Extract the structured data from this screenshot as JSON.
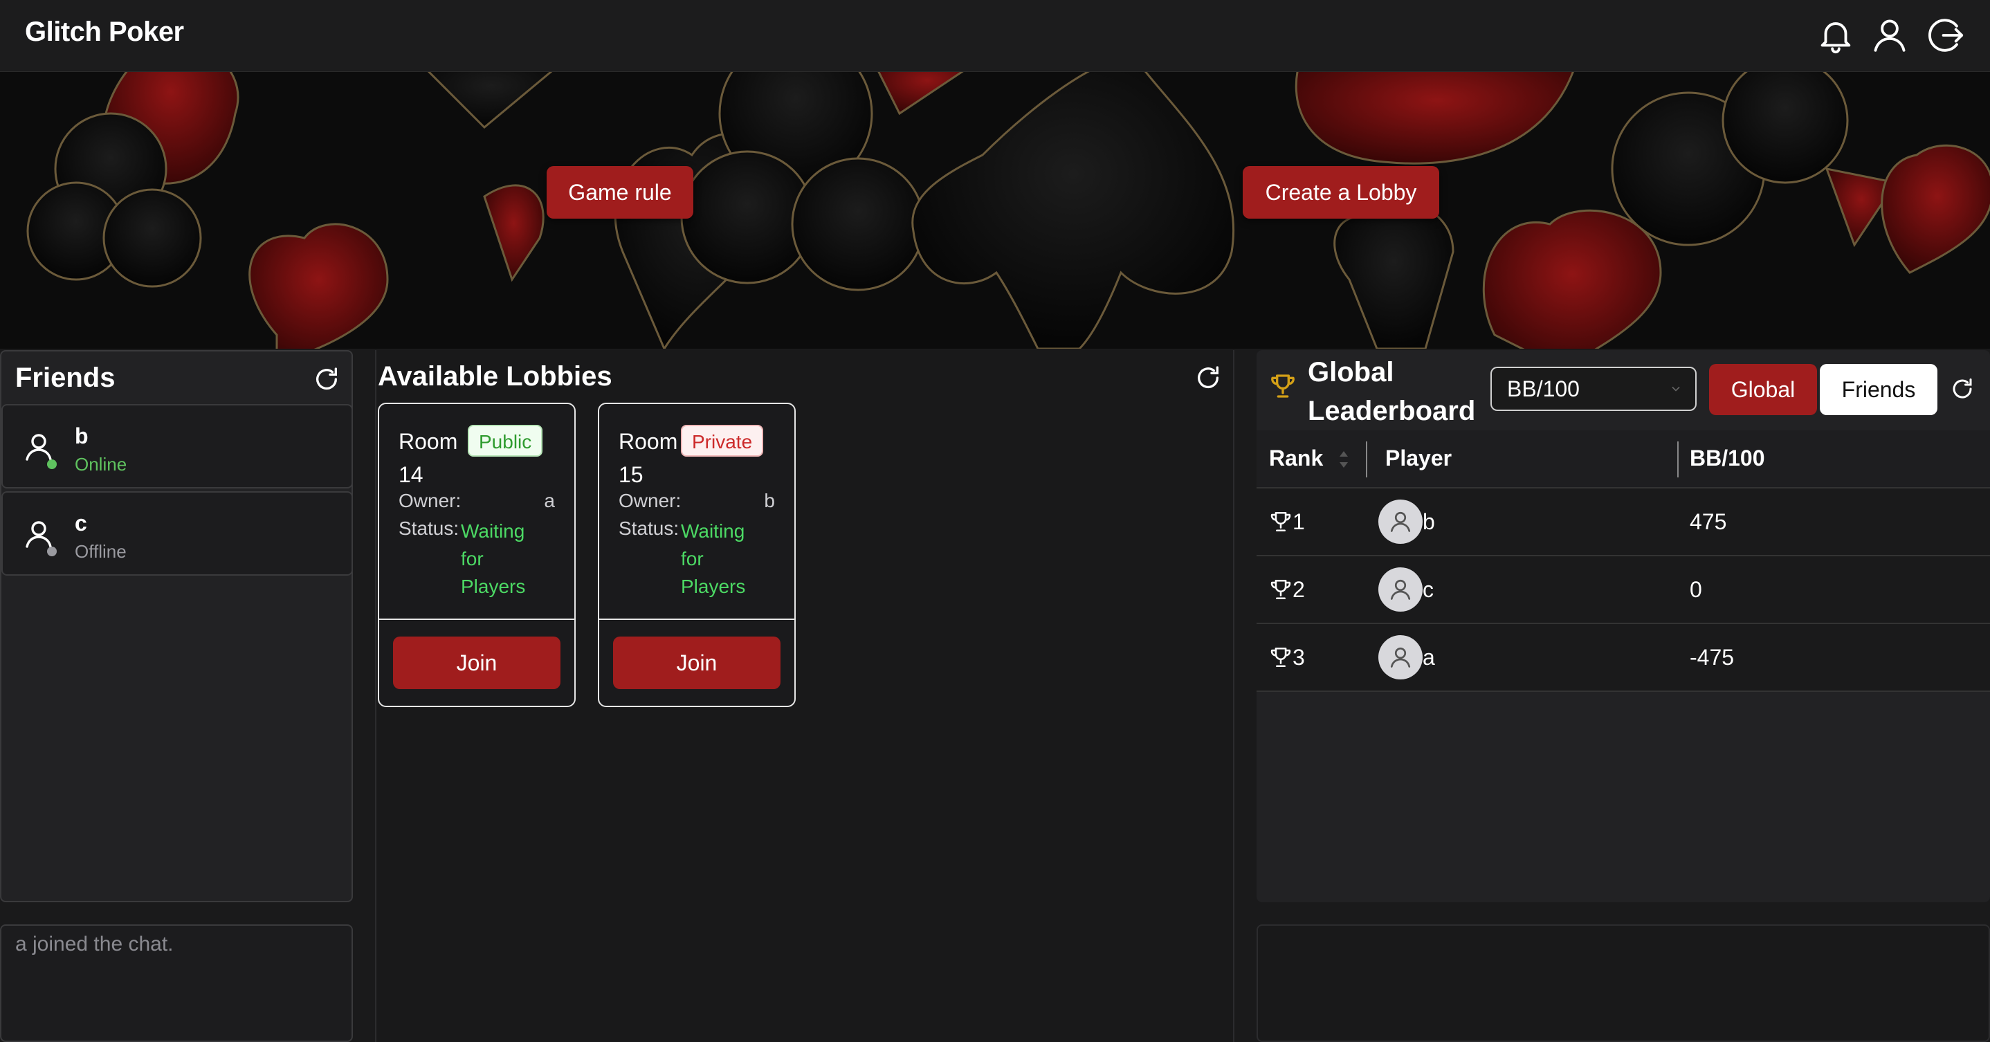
{
  "app": {
    "title": "Glitch Poker"
  },
  "header": {
    "icons": [
      "bell-icon",
      "user-icon",
      "logout-icon"
    ]
  },
  "hero": {
    "game_rule_label": "Game rule",
    "create_lobby_label": "Create a Lobby"
  },
  "friends": {
    "title": "Friends",
    "items": [
      {
        "name": "b",
        "status": "Online",
        "status_color": "#5fc25f"
      },
      {
        "name": "c",
        "status": "Offline",
        "status_color": "#9a9aa0"
      }
    ]
  },
  "chat": {
    "messages": [
      "a joined the chat."
    ]
  },
  "lobbies": {
    "title": "Available Lobbies",
    "items": [
      {
        "room_word": "Room",
        "room_number": "14",
        "visibility": "Public",
        "owner_label": "Owner:",
        "owner": "a",
        "status_label": "Status:",
        "status": "Waiting for Players",
        "join_label": "Join"
      },
      {
        "room_word": "Room",
        "room_number": "15",
        "visibility": "Private",
        "owner_label": "Owner:",
        "owner": "b",
        "status_label": "Status:",
        "status": "Waiting for Players",
        "join_label": "Join"
      }
    ]
  },
  "leaderboard": {
    "title_line1": "Global",
    "title_line2": "Leaderboard",
    "metric": "BB/100",
    "tabs": [
      {
        "label": "Global",
        "active": true
      },
      {
        "label": "Friends",
        "active": false
      }
    ],
    "columns": [
      "Rank",
      "Player",
      "BB/100"
    ],
    "rows": [
      {
        "rank": "1",
        "player": "b",
        "value": "475"
      },
      {
        "rank": "2",
        "player": "c",
        "value": "0"
      },
      {
        "rank": "3",
        "player": "a",
        "value": "-475"
      }
    ]
  },
  "colors": {
    "accent": "#a01d1d",
    "online": "#5fc25f",
    "status_green": "#4cd964",
    "trophy_gold": "#d4a017"
  }
}
